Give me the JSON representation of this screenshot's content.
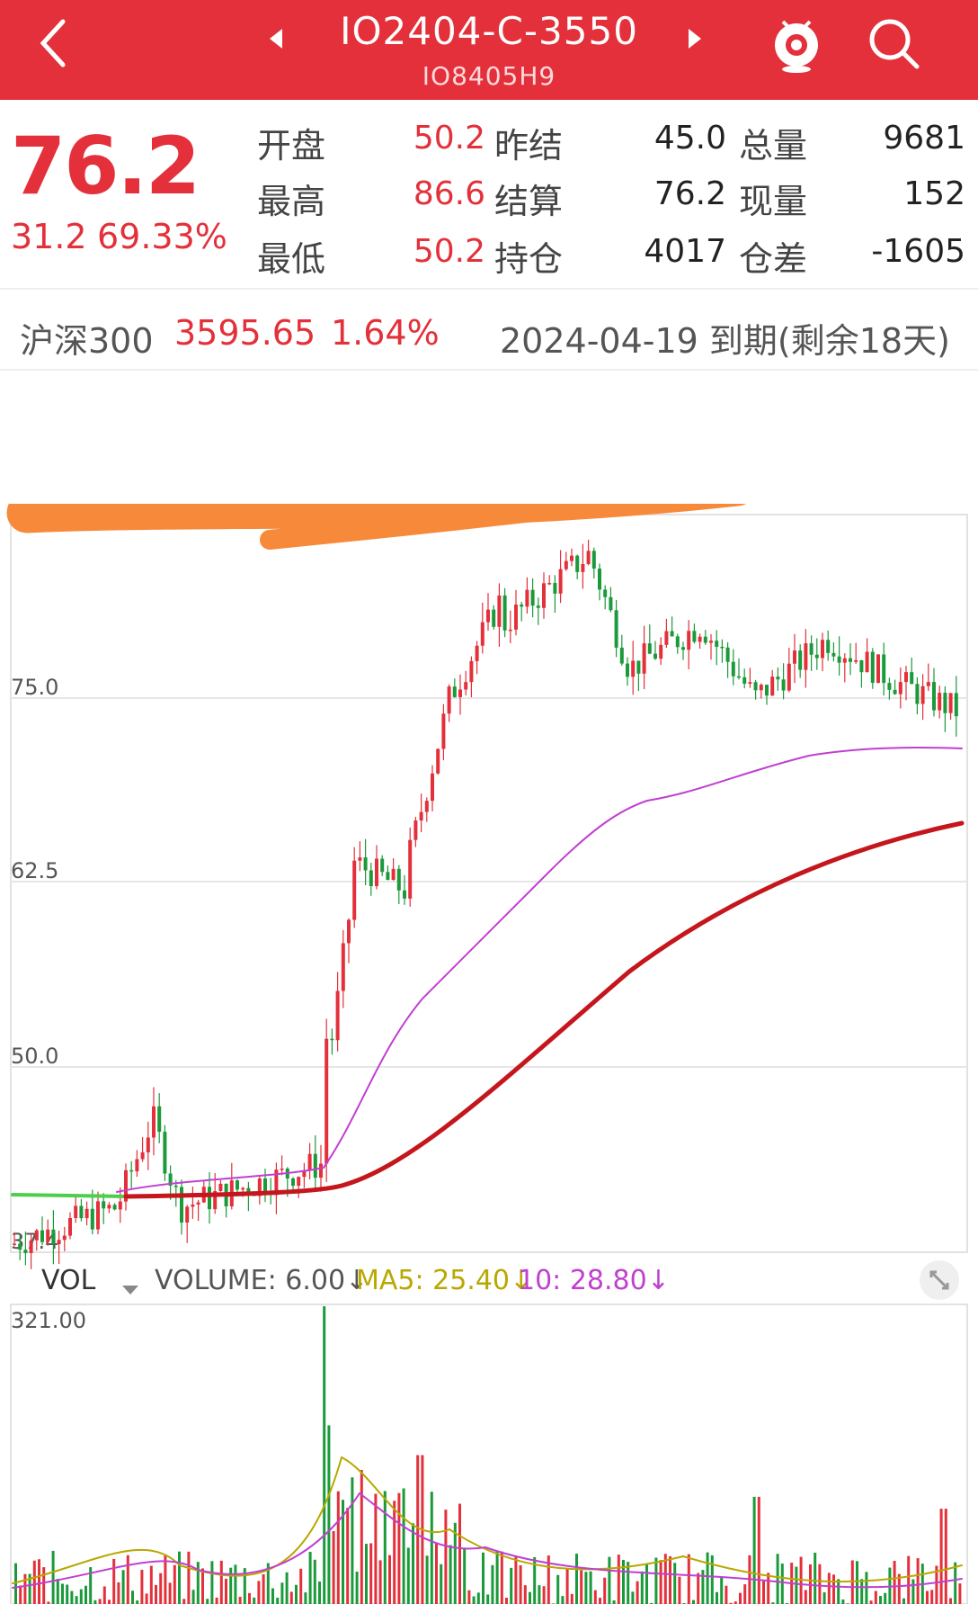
{
  "header": {
    "title": "IO2404-C-3550",
    "subtitle": "IO8405H9",
    "colors": {
      "bar": "#e3303a",
      "text": "#ffffff"
    }
  },
  "quote": {
    "last_price": "76.2",
    "change": "31.2",
    "change_pct": "69.33%",
    "rows": [
      {
        "l1": "开盘",
        "v1": "50.2",
        "l2": "昨结",
        "v2": "45.0",
        "l3": "总量",
        "v3": "9681"
      },
      {
        "l1": "最高",
        "v1": "86.6",
        "l2": "结算",
        "v2": "76.2",
        "l3": "现量",
        "v3": "152"
      },
      {
        "l1": "最低",
        "v1": "50.2",
        "l2": "持仓",
        "v2": "4017",
        "l3": "仓差",
        "v3": "-1605"
      }
    ]
  },
  "index_row": {
    "index_name": "沪深300",
    "index_value": "3595.65",
    "index_change_pct": "1.64%",
    "expiry": "2024-04-19 到期(剩余18天)"
  },
  "price_chart": {
    "y_labels": [
      "75.0",
      "62.5",
      "50.0",
      "37.4"
    ],
    "colors": {
      "up": "#e3303a",
      "down": "#1a9a3a",
      "ma_long": "#c4161c",
      "ma_mid": "#c040d0",
      "ma_green": "#4ccf4c"
    }
  },
  "volume": {
    "label": "VOL",
    "volume": "VOLUME: 6.00↓",
    "ma5": "MA5: 25.40↓",
    "ma10": "10: 28.80↓",
    "y_max_label": "321.00",
    "colors": {
      "ma5": "#b8a800",
      "ma10": "#c040d0",
      "volume_label": "#555"
    }
  }
}
